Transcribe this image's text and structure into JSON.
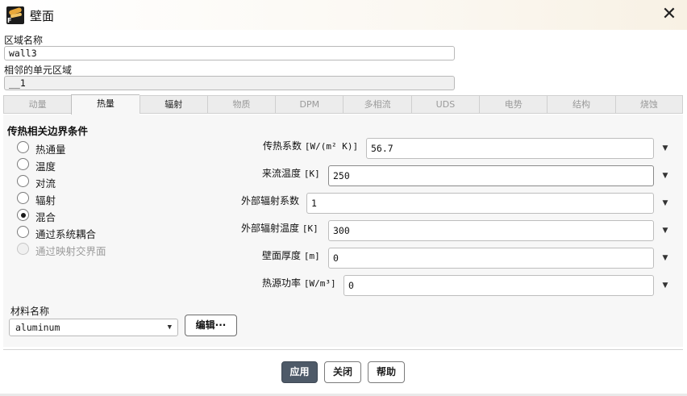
{
  "window": {
    "title": "壁面",
    "close_symbol": "✕"
  },
  "zone_name": {
    "label": "区域名称",
    "value": "wall3"
  },
  "adjacent_zone": {
    "label": "相邻的单元区域",
    "value": "__1"
  },
  "tabs": [
    {
      "label": "动量",
      "state": "disabled"
    },
    {
      "label": "热量",
      "state": "active"
    },
    {
      "label": "辐射",
      "state": "enabled"
    },
    {
      "label": "物质",
      "state": "disabled"
    },
    {
      "label": "DPM",
      "state": "disabled"
    },
    {
      "label": "多相流",
      "state": "disabled"
    },
    {
      "label": "UDS",
      "state": "disabled"
    },
    {
      "label": "电势",
      "state": "disabled"
    },
    {
      "label": "结构",
      "state": "disabled"
    },
    {
      "label": "烧蚀",
      "state": "disabled"
    }
  ],
  "thermal": {
    "section_title": "传热相关边界条件",
    "options": [
      {
        "label": "热通量",
        "checked": false,
        "disabled": false
      },
      {
        "label": "温度",
        "checked": false,
        "disabled": false
      },
      {
        "label": "对流",
        "checked": false,
        "disabled": false
      },
      {
        "label": "辐射",
        "checked": false,
        "disabled": false
      },
      {
        "label": "混合",
        "checked": true,
        "disabled": false
      },
      {
        "label": "通过系统耦合",
        "checked": false,
        "disabled": false
      },
      {
        "label": "通过映射交界面",
        "checked": false,
        "disabled": true
      }
    ],
    "params": [
      {
        "label": "传热系数",
        "unit": "[W/(m² K)]",
        "value": "56.7"
      },
      {
        "label": "来流温度",
        "unit": "[K]",
        "value": "250"
      },
      {
        "label": "外部辐射系数",
        "unit": "",
        "value": "1"
      },
      {
        "label": "外部辐射温度",
        "unit": "[K]",
        "value": "300"
      },
      {
        "label": "壁面厚度",
        "unit": "[m]",
        "value": "0"
      },
      {
        "label": "热源功率",
        "unit": "[W/m³]",
        "value": "0"
      }
    ]
  },
  "material": {
    "label": "材料名称",
    "value": "aluminum",
    "edit_label": "编辑···"
  },
  "buttons": {
    "apply": "应用",
    "close": "关闭",
    "help": "帮助"
  },
  "icons": {
    "app": "fluent-app-icon",
    "dropdown": "▼"
  }
}
